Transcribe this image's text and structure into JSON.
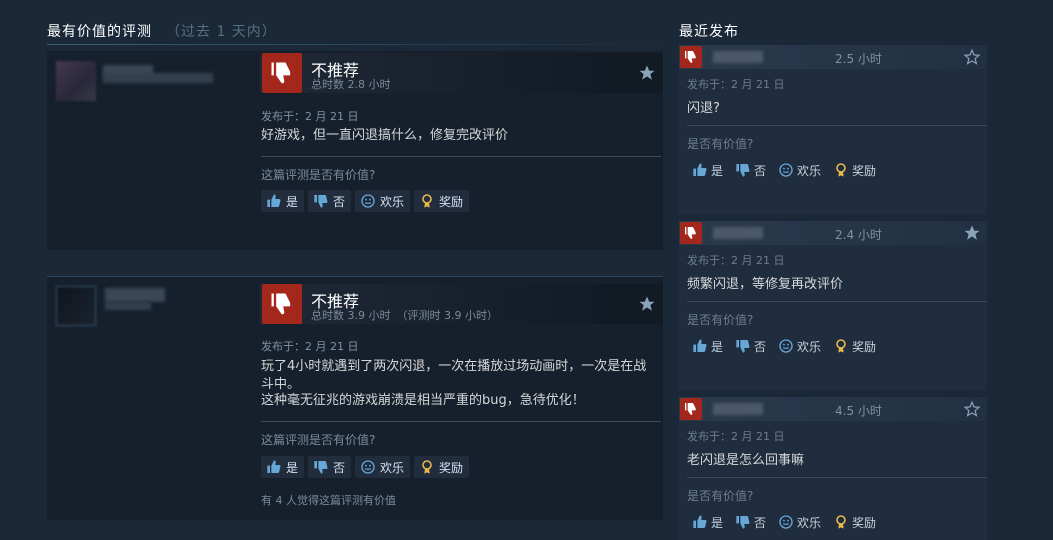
{
  "most_helpful": {
    "title": "最有价值的评测",
    "period": "（过去 1 天内）"
  },
  "recent": {
    "title": "最近发布"
  },
  "labels": {
    "question": "这篇评测是否有价值?",
    "recent_question": "是否有价值?",
    "yes": "是",
    "no": "否",
    "funny": "欢乐",
    "award": "奖励"
  },
  "reviews": [
    {
      "recommendation": "不推荐",
      "hours": "总时数 2.8 小时",
      "hours_at_review": "",
      "posted": "发布于：2 月 21 日",
      "text": "好游戏，但一直闪退搞什么，修复完改评价",
      "helpful_count": ""
    },
    {
      "recommendation": "不推荐",
      "hours": "总时数 3.9 小时",
      "hours_at_review": "（评测时 3.9 小时）",
      "posted": "发布于：2 月 21 日",
      "text_line1": "玩了4小时就遇到了两次闪退，一次在播放过场动画时，一次是在战斗中。",
      "text_line2": "这种毫无征兆的游戏崩溃是相当严重的bug，急待优化！",
      "helpful_count": "有 4 人觉得这篇评测有价值"
    }
  ],
  "recent_reviews": [
    {
      "time": "2.5 小时",
      "posted": "发布于：2 月 21 日",
      "text": "闪退?"
    },
    {
      "time": "2.4 小时",
      "posted": "发布于：2 月 21 日",
      "text": "频繁闪退，等修复再改评价"
    },
    {
      "time": "4.5 小时",
      "posted": "发布于：2 月 21 日",
      "text": "老闪退是怎么回事嘛"
    }
  ],
  "colors": {
    "background": "#1b2838",
    "not_recommended": "#a3271b",
    "award_gold": "#e8b94a",
    "vote_blue": "#67a7d8"
  }
}
